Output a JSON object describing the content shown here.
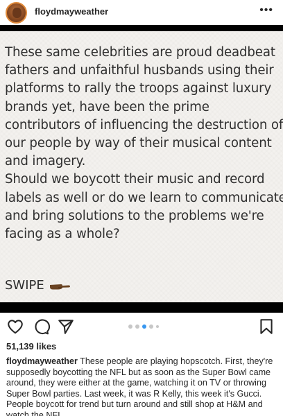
{
  "header": {
    "username": "floydmayweather",
    "more_label": "•••"
  },
  "post": {
    "lines": [
      "These same celebrities are proud deadbeat",
      "fathers and unfaithful husbands using their",
      "platforms to rally the troops against luxury",
      "brands yet, have been the prime",
      "contributors of influencing the destruction of",
      "our people by way of their musical content",
      "and imagery.",
      "Should we boycott their music and record",
      "labels as well or do we learn to communicate",
      "and bring solutions to the problems we're",
      "facing as a whole?"
    ],
    "swipe_text": "SWIPE",
    "swipe_icon": "pointing-hand-icon",
    "background_color": "#f3f1ee"
  },
  "actions": {
    "like_icon": "heart-icon",
    "comment_icon": "comment-icon",
    "share_icon": "send-icon",
    "save_icon": "bookmark-icon",
    "carousel_slide_count": 5,
    "carousel_active_index": 2
  },
  "likes": {
    "text": "51,139 likes"
  },
  "caption": {
    "username": "floydmayweather",
    "text": "These people are playing hopscotch. First, they're supposedly boycotting the NFL but as soon as the Super Bowl came around, they were either at the game, watching it on TV or throwing Super Bowl parties. Last week, it was R Kelly, this week it's Gucci. People boycott for trend but turn around and still shop at H&M and watch the NFL."
  },
  "colors": {
    "accent_blue": "#3897f0",
    "text": "#262626"
  }
}
